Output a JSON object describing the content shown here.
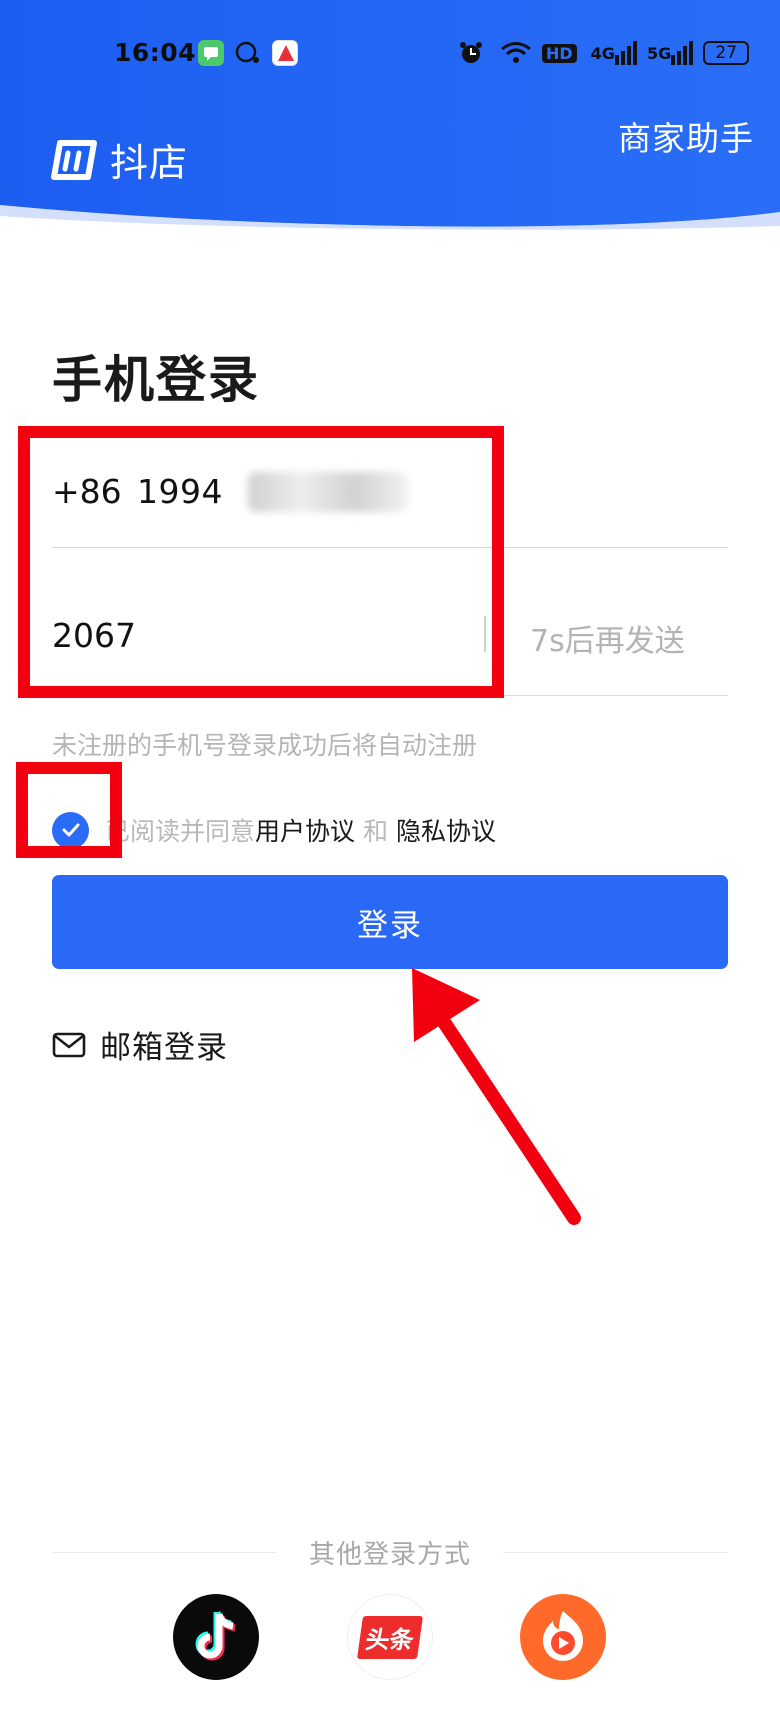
{
  "status_bar": {
    "time": "16:04",
    "hd_label": "HD",
    "net_4g": "4G",
    "net_5g": "5G",
    "battery": "27"
  },
  "header": {
    "app_name": "抖店",
    "merchant_link": "商家助手"
  },
  "login": {
    "title": "手机登录",
    "country_code": "+86",
    "phone_number": "1994",
    "verification_code": "2067",
    "resend_label": "7s后再发送",
    "hint": "未注册的手机号登录成功后将自动注册",
    "agree_prefix": "已阅读并同意",
    "user_agreement": "用户协议",
    "and_text": "和",
    "privacy_policy": "隐私协议",
    "login_button": "登录",
    "email_login": "邮箱登录"
  },
  "other_login": {
    "title": "其他登录方式",
    "providers": [
      {
        "name": "douyin-icon"
      },
      {
        "name": "toutiao-icon",
        "label": "头条"
      },
      {
        "name": "huoshan-icon"
      }
    ]
  },
  "colors": {
    "brand_blue": "#2969f6",
    "header_blue": "#1f63f2",
    "annotation_red": "#f2000f"
  }
}
